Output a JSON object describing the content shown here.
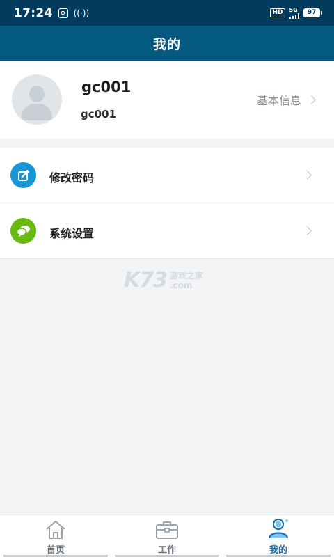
{
  "status_bar": {
    "time": "17:24",
    "hd_label": "HD",
    "network_label": "5G",
    "battery_level": "97"
  },
  "header": {
    "title": "我的"
  },
  "profile": {
    "name": "gc001",
    "username": "gc001",
    "basic_info_label": "基本信息"
  },
  "menu": {
    "items": [
      {
        "label": "修改密码",
        "icon": "edit-icon",
        "color": "#1995d6"
      },
      {
        "label": "系统设置",
        "icon": "chat-bubble-icon",
        "color": "#69b90e"
      }
    ]
  },
  "watermark": {
    "main": "K73",
    "line1": "游戏之家",
    "line2": ".com"
  },
  "tabbar": {
    "tabs": [
      {
        "label": "首页",
        "icon": "home-icon",
        "active": false
      },
      {
        "label": "工作",
        "icon": "briefcase-icon",
        "active": false
      },
      {
        "label": "我的",
        "icon": "user-icon",
        "active": true
      }
    ]
  },
  "colors": {
    "status_bar": "#033b5f",
    "title_bar": "#03597f",
    "accent": "#1a6fae",
    "background": "#f3f4f6"
  }
}
